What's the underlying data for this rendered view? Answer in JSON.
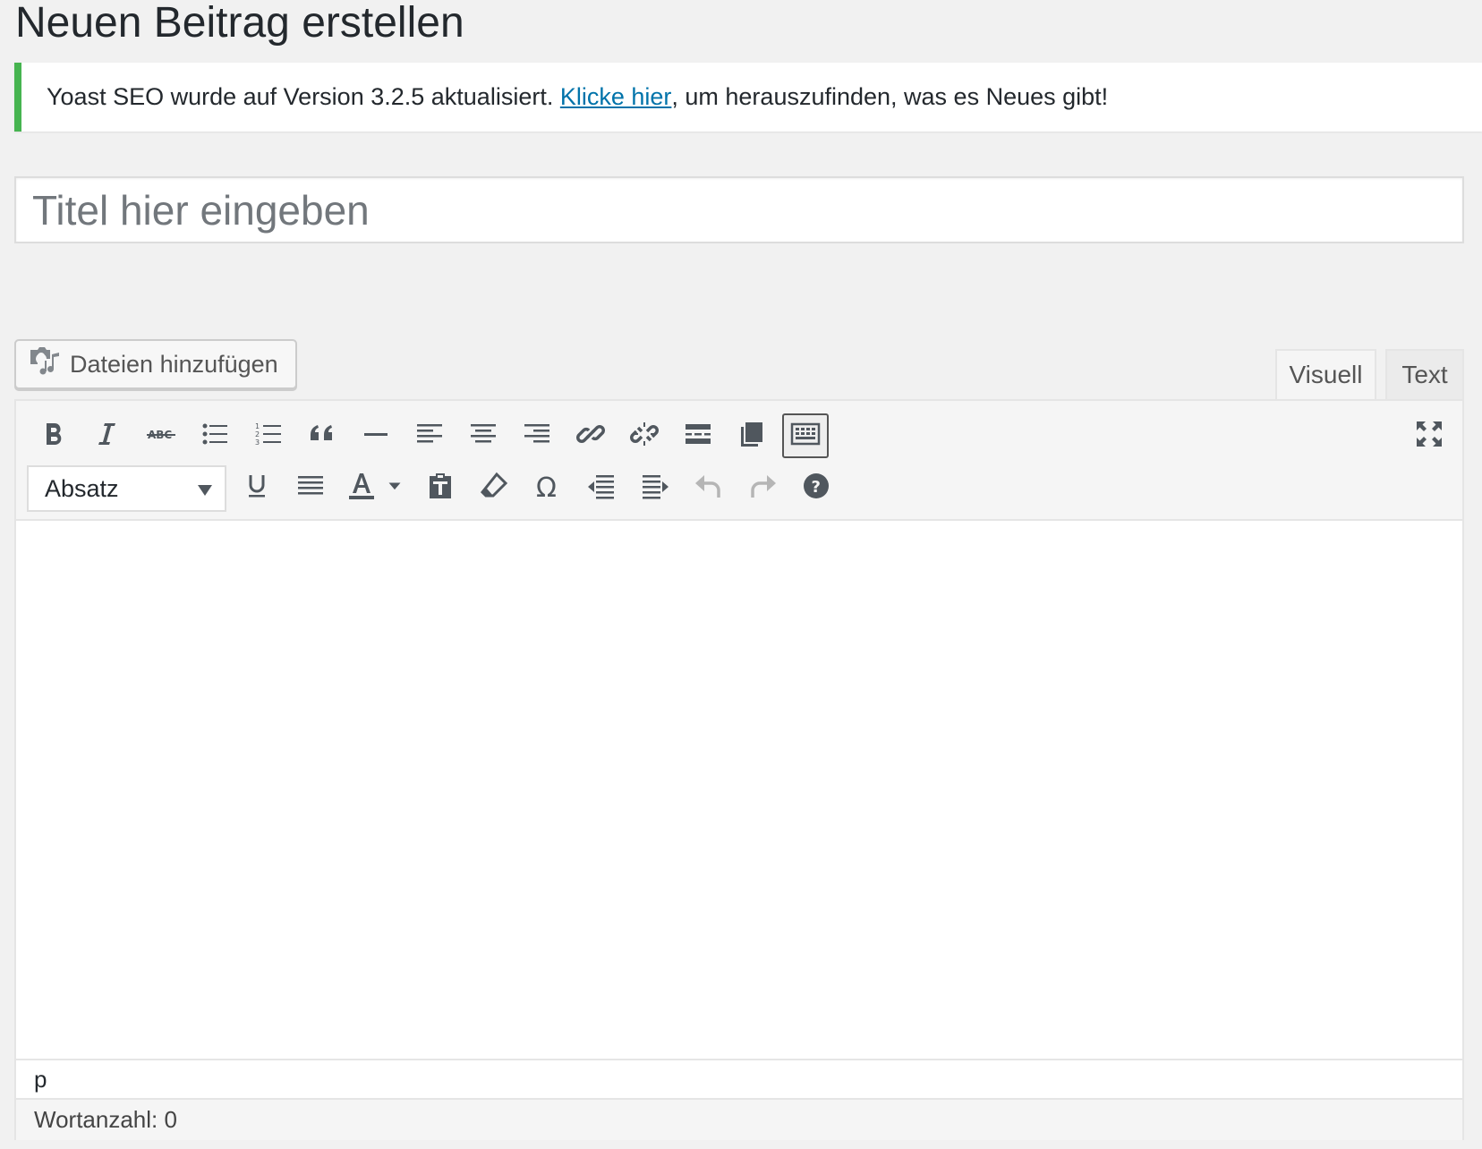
{
  "page": {
    "title": "Neuen Beitrag erstellen"
  },
  "notice": {
    "text_before": "Yoast SEO wurde auf Version 3.2.5 aktualisiert. ",
    "link_text": "Klicke hier",
    "text_after": ", um herauszufinden, was es Neues gibt!",
    "accent_color": "#46b450"
  },
  "title_field": {
    "placeholder": "Titel hier eingeben",
    "value": ""
  },
  "media_button": {
    "label": "Dateien hinzufügen",
    "icon": "add-media-icon"
  },
  "tabs": {
    "visual": "Visuell",
    "text": "Text",
    "active": "visual"
  },
  "toolbar": {
    "row1": [
      "bold-icon",
      "italic-icon",
      "strikethrough-icon",
      "bullet-list-icon",
      "numbered-list-icon",
      "blockquote-icon",
      "horizontal-line-icon",
      "align-left-icon",
      "align-center-icon",
      "align-right-icon",
      "insert-link-icon",
      "remove-link-icon",
      "read-more-icon",
      "distraction-free-icon",
      "toolbar-toggle-icon"
    ],
    "row2": [
      "underline-icon",
      "justify-icon",
      "text-color-icon",
      "paste-as-text-icon",
      "clear-formatting-icon",
      "special-character-icon",
      "outdent-icon",
      "indent-icon",
      "undo-icon",
      "redo-icon",
      "help-icon"
    ],
    "format_select": {
      "value": "Absatz"
    },
    "fullscreen_icon": "fullscreen-icon"
  },
  "editor": {
    "path": "p",
    "word_count_label": "Wortanzahl: 0"
  }
}
